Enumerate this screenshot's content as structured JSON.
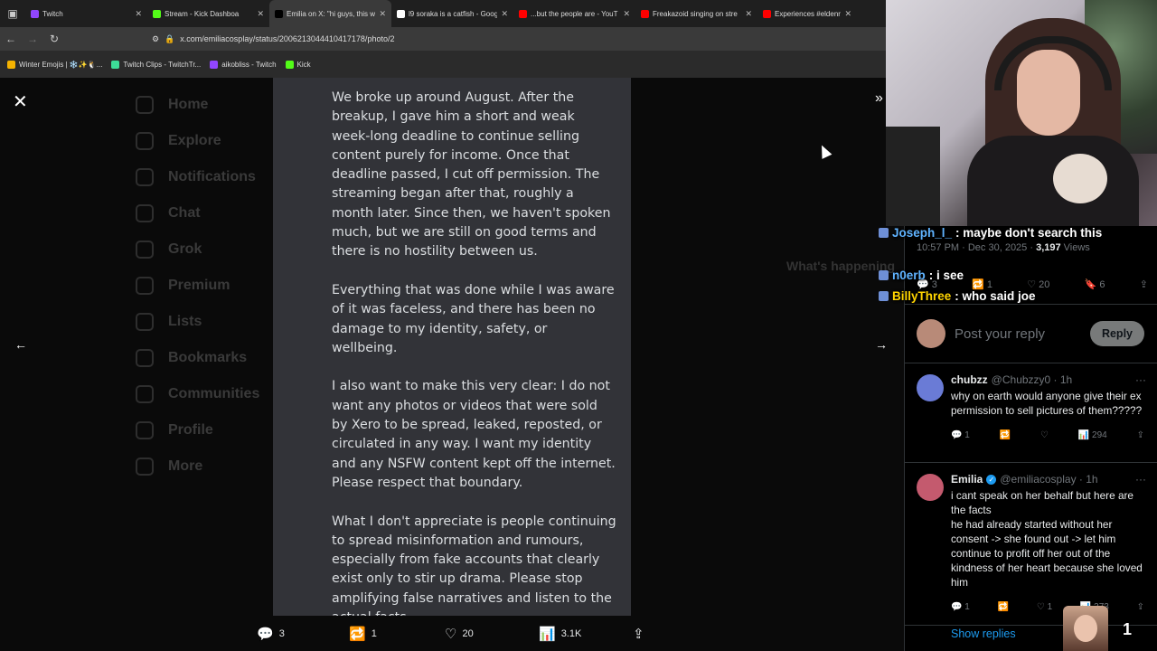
{
  "browser": {
    "tabs": [
      {
        "label": "Twitch",
        "color": "#9146ff",
        "active": false
      },
      {
        "label": "Stream - Kick Dashboa",
        "color": "#53fc18",
        "active": false
      },
      {
        "label": "Emilia on X: \"hi guys, this w",
        "color": "#000000",
        "active": true
      },
      {
        "label": "l9 soraka is a catfish - Goog",
        "color": "#ffffff",
        "active": false
      },
      {
        "label": "...but the people are - YouT",
        "color": "#ff0000",
        "active": false
      },
      {
        "label": "Freakazoid singing on stre",
        "color": "#ff0000",
        "active": false
      },
      {
        "label": "Experiences #eldenring #el",
        "color": "#ff0000",
        "active": false
      }
    ],
    "url": "x.com/emiliacosplay/status/2006213044410417178/photo/2",
    "bookmarks": [
      {
        "label": "Winter Emojis | ❄️✨🐧...",
        "color": "#f5b301"
      },
      {
        "label": "Twitch Clips - TwitchTr...",
        "color": "#3ddc97"
      },
      {
        "label": "aikobliss - Twitch",
        "color": "#9146ff"
      },
      {
        "label": "Kick",
        "color": "#53fc18"
      }
    ]
  },
  "background_nav": [
    "Home",
    "Explore",
    "Notifications",
    "Chat",
    "Grok",
    "Premium",
    "Lists",
    "Bookmarks",
    "Communities",
    "Profile",
    "More"
  ],
  "background_right": {
    "heading": "What's happening"
  },
  "document": {
    "paragraphs": [
      "We broke up around August. After the breakup, I gave him a short and weak week-long deadline to continue selling content purely for income. Once that deadline passed, I cut off permission. The streaming began after that, roughly a month later. Since then, we haven't spoken much, but we are still on good terms and there is no hostility between us.",
      "Everything that was done while I was aware of it was faceless, and there has been no damage to my identity, safety, or wellbeing.",
      "I also want to make this very clear: I do not want any photos or videos that were sold by Xero to be spread, leaked, reposted, or circulated in any way. I want my identity and any NSFW content kept off the internet. Please respect that boundary.",
      "What I don't appreciate is people continuing to spread misinformation and rumours, especially from fake accounts that clearly exist only to stir up drama. Please stop amplifying false narratives and listen to the actual facts."
    ]
  },
  "media_actions": {
    "replies": "3",
    "reposts": "1",
    "likes": "20",
    "views": "3.1K"
  },
  "chat": [
    {
      "user": "Joseph_l_",
      "user_color": "#5fb3ff",
      "msg": ": maybe don't search this"
    },
    {
      "user": "n0erb",
      "user_color": "#5fb3ff",
      "msg": ": i see"
    },
    {
      "user": "BillyThree",
      "user_color": "#ffd400",
      "msg": ": who said joe"
    }
  ],
  "tweet_meta": {
    "time": "10:57 PM · Dec 30, 2025 · ",
    "views_count": "3,197",
    "views_label": " Views"
  },
  "tweet_stats": {
    "replies": "3",
    "reposts": "1",
    "likes": "20",
    "bookmarks": "6"
  },
  "reply_box": {
    "placeholder": "Post your reply",
    "button": "Reply"
  },
  "replies": [
    {
      "name": "chubzz",
      "handle": "@Chubzzy0 · 1h",
      "verified": false,
      "text": "why on earth would anyone give their ex permission to sell pictures of them?????",
      "replies": "1",
      "reposts": "",
      "likes": "",
      "views": "294",
      "avatar_color": "#6a7bd6"
    },
    {
      "name": "Emilia",
      "handle": "@emiliacosplay · 1h",
      "verified": true,
      "text": "i cant speak on her behalf but here are the facts\nhe had already started without her consent -> she found out -> let him continue to profit off her out of the kindness of her heart because she loved him",
      "replies": "1",
      "reposts": "",
      "likes": "1",
      "views": "373",
      "avatar_color": "#c45a6e"
    }
  ],
  "show_replies": "Show replies",
  "viewer_count": "1"
}
